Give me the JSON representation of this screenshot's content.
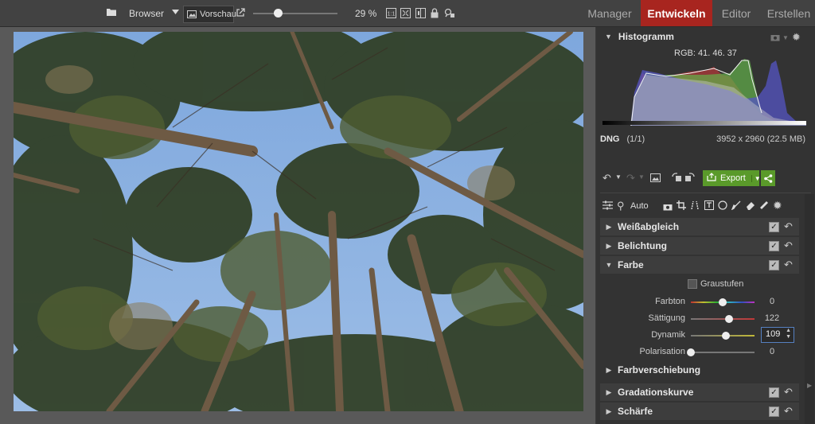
{
  "topbar": {
    "browser_label": "Browser",
    "preview_label": "Vorschau",
    "zoom_value": "29 %",
    "zoom_level": 0.29
  },
  "modules": [
    {
      "label": "Manager"
    },
    {
      "label": "Entwickeln"
    },
    {
      "label": "Editor"
    },
    {
      "label": "Erstellen"
    }
  ],
  "histogram": {
    "title": "Histogramm",
    "rgb_readout": "RGB: 41, 46, 37"
  },
  "fileinfo": {
    "format": "DNG",
    "index": "(1/1)",
    "dimensions": "3952 x 2960 (22.5 MB)"
  },
  "actions": {
    "export_label": "Export",
    "auto_label": "Auto"
  },
  "sections": {
    "weissabgleich": "Weißabgleich",
    "belichtung": "Belichtung",
    "farbe": "Farbe",
    "farbverschiebung": "Farbverschiebung",
    "gradationskurve": "Gradationskurve",
    "schaerfe": "Schärfe"
  },
  "farbe": {
    "graustufen_label": "Graustufen",
    "sliders": [
      {
        "label": "Farbton",
        "value": "0",
        "position": 0.5
      },
      {
        "label": "Sättigung",
        "value": "122",
        "position": 0.6
      },
      {
        "label": "Dynamik",
        "value": "109",
        "position": 0.55
      },
      {
        "label": "Polarisation",
        "value": "0",
        "position": 0.0
      }
    ]
  },
  "colors": {
    "accent": "#a8251f",
    "export_green": "#5a9a2a",
    "histogram_red": "#c0383a",
    "histogram_green": "#5fb04a",
    "histogram_blue": "#5a5fc0"
  }
}
